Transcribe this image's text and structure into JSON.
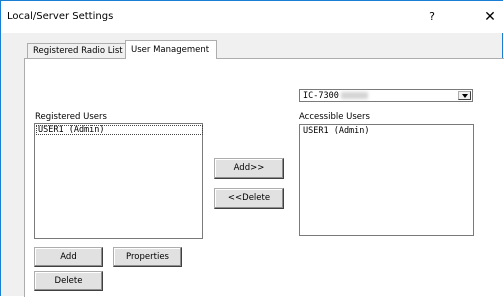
{
  "window": {
    "title": "Local/Server Settings",
    "help_glyph": "?",
    "close_glyph": "✕"
  },
  "tabs": [
    {
      "label": "Registered Radio List",
      "active": false
    },
    {
      "label": "User Management",
      "active": true
    }
  ],
  "radio_select": {
    "value": "IC-7300"
  },
  "registered_users": {
    "label": "Registered Users",
    "items": [
      "USER1 (Admin)"
    ]
  },
  "accessible_users": {
    "label": "Accessible Users",
    "items": [
      "USER1 (Admin)"
    ]
  },
  "buttons": {
    "add_access": "Add>>",
    "delete_access": "<<Delete",
    "add": "Add",
    "properties": "Properties",
    "delete": "Delete"
  }
}
